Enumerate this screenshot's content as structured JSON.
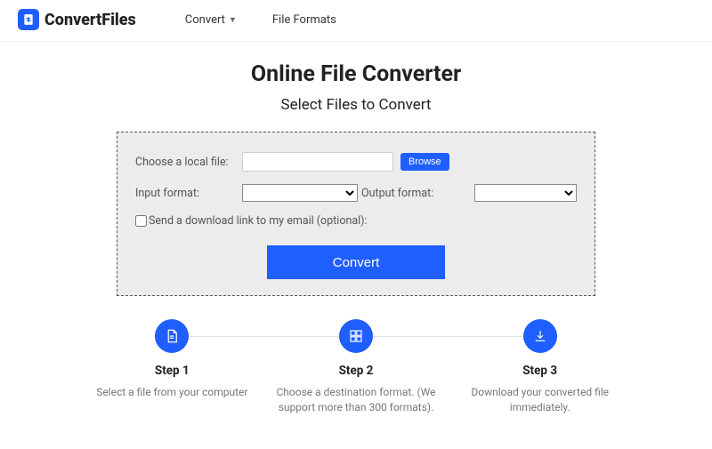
{
  "header": {
    "logo_text": "ConvertFiles",
    "nav": {
      "convert": "Convert",
      "file_formats": "File Formats"
    }
  },
  "main": {
    "title": "Online File Converter",
    "subtitle": "Select Files to Convert"
  },
  "form": {
    "choose_file_label": "Choose a local file:",
    "browse_label": "Browse",
    "input_format_label": "Input format:",
    "output_format_label": "Output format:",
    "email_checkbox_label": "Send a download link to my email (optional):",
    "convert_button_label": "Convert"
  },
  "steps": [
    {
      "title": "Step 1",
      "desc": "Select a file from your computer"
    },
    {
      "title": "Step 2",
      "desc": "Choose a destination format. (We support more than 300 formats)."
    },
    {
      "title": "Step 3",
      "desc": "Download your converted file immediately."
    }
  ]
}
